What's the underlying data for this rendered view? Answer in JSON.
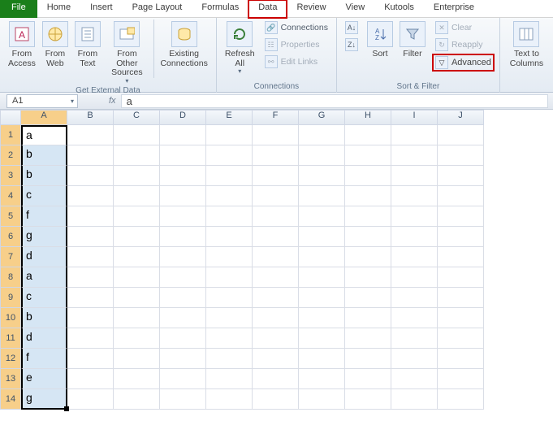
{
  "tabs": {
    "file": "File",
    "home": "Home",
    "insert": "Insert",
    "pageLayout": "Page Layout",
    "formulas": "Formulas",
    "data": "Data",
    "review": "Review",
    "view": "View",
    "kutools": "Kutools",
    "enterprise": "Enterprise"
  },
  "ribbon": {
    "getExt": {
      "label": "Get External Data",
      "fromAccess": "From\nAccess",
      "fromWeb": "From\nWeb",
      "fromText": "From\nText",
      "fromOther": "From Other\nSources",
      "existing": "Existing\nConnections"
    },
    "connections": {
      "label": "Connections",
      "refresh": "Refresh\nAll",
      "conn": "Connections",
      "props": "Properties",
      "edit": "Edit Links"
    },
    "sortFilter": {
      "label": "Sort & Filter",
      "sort": "Sort",
      "filter": "Filter",
      "clear": "Clear",
      "reapply": "Reapply",
      "advanced": "Advanced"
    },
    "tools": {
      "textToCols": "Text to\nColumns"
    }
  },
  "namebox": "A1",
  "formula": "a",
  "columns": [
    "A",
    "B",
    "C",
    "D",
    "E",
    "F",
    "G",
    "H",
    "I",
    "J"
  ],
  "rows": [
    1,
    2,
    3,
    4,
    5,
    6,
    7,
    8,
    9,
    10,
    11,
    12,
    13,
    14
  ],
  "cellsA": [
    "a",
    "b",
    "b",
    "c",
    "f",
    "g",
    "d",
    "a",
    "c",
    "b",
    "d",
    "f",
    "e",
    "g"
  ]
}
